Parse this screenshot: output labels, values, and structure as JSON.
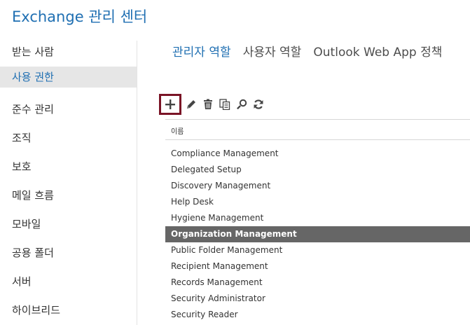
{
  "app": {
    "title": "Exchange 관리 센터"
  },
  "sidebar": {
    "items": [
      {
        "label": "받는 사람"
      },
      {
        "label": "사용 권한"
      },
      {
        "label": "준수 관리"
      },
      {
        "label": "조직"
      },
      {
        "label": "보호"
      },
      {
        "label": "메일 흐름"
      },
      {
        "label": "모바일"
      },
      {
        "label": "공용 폴더"
      },
      {
        "label": "서버"
      },
      {
        "label": "하이브리드"
      }
    ],
    "active_index": 1
  },
  "tabs": [
    {
      "label": "관리자 역할"
    },
    {
      "label": "사용자 역할"
    },
    {
      "label": "Outlook Web App 정책"
    }
  ],
  "toolbar": {
    "icons": [
      "add-icon",
      "edit-icon",
      "delete-icon",
      "copy-icon",
      "search-icon",
      "refresh-icon"
    ]
  },
  "table": {
    "column_name": "이름",
    "rows": [
      {
        "label": "Compliance Management"
      },
      {
        "label": "Delegated Setup"
      },
      {
        "label": "Discovery Management"
      },
      {
        "label": "Help Desk"
      },
      {
        "label": "Hygiene Management"
      },
      {
        "label": "Organization Management"
      },
      {
        "label": "Public Folder Management"
      },
      {
        "label": "Recipient Management"
      },
      {
        "label": "Records Management"
      },
      {
        "label": "Security Administrator"
      },
      {
        "label": "Security Reader"
      }
    ],
    "selected_index": 5
  },
  "colors": {
    "accent": "#1f6fb2",
    "highlight_border": "#7a1426",
    "selected_row": "#666666",
    "active_nav_bg": "#e6e6e6"
  }
}
